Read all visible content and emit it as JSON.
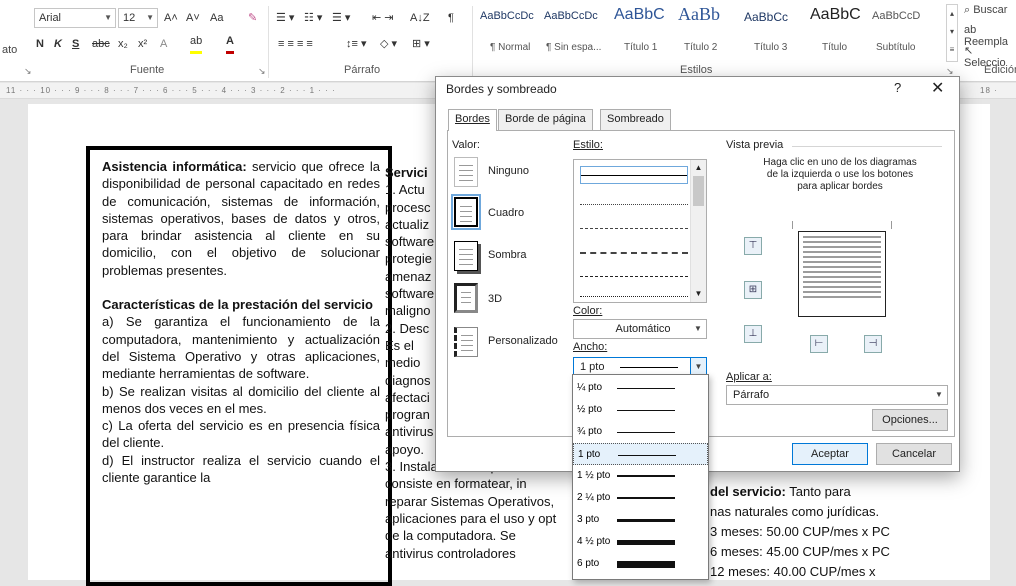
{
  "ribbon": {
    "font_name": "Arial",
    "font_size": "12",
    "grow_font": "A˄",
    "shrink_font": "A˅",
    "change_case": "Aa",
    "clear_format": "✎",
    "bold": "N",
    "italic": "K",
    "underline": "S",
    "strike": "abc",
    "subscript": "x₂",
    "superscript": "x²",
    "text_effects": "A",
    "highlight": "ab",
    "font_color": "A",
    "pilcrow": "¶",
    "sort": "A↓Z",
    "left_cut": "ato",
    "group_fuente": "Fuente",
    "group_parrafo": "Párrafo",
    "group_estilos": "Estilos",
    "group_edicion": "Edición",
    "buscar": "Buscar",
    "reemplazar": "Reempla",
    "seleccionar": "Seleccio",
    "styles": [
      {
        "sample": "AaBbCcDc",
        "name": "¶ Normal"
      },
      {
        "sample": "AaBbCcDc",
        "name": "¶ Sin espa..."
      },
      {
        "sample": "AaBbC",
        "name": "Título 1"
      },
      {
        "sample": "AaBb",
        "name": "Título 2"
      },
      {
        "sample": "AaBbCc",
        "name": "Título 3"
      },
      {
        "sample": "AaBbC",
        "name": "Título"
      },
      {
        "sample": "AaBbCcD",
        "name": "Subtítulo"
      }
    ],
    "ruler": "11 · · · 10 · · · 9 · · · 8 · · · 7 · · · 6 · · · 5 · · · 4 · · · 3 · · · 2 · · · 1 · · ·",
    "ruler_right": "18 ·"
  },
  "document": {
    "box": [
      {
        "bold": "Asistencia informática:",
        "text": " servicio que ofrece la disponibilidad de personal capacitado en redes de comunicación, sistemas de información, sistemas operativos, bases de datos y otros, para brindar asistencia al cliente en su domicilio, con el objetivo de solucionar problemas presentes."
      },
      {
        "bold": "Características de la prestación del servicio",
        "text": ""
      },
      {
        "bold": "",
        "text": "a) Se garantiza el funcionamiento de la computadora, mantenimiento y actualización del Sistema Operativo y otras aplicaciones, mediante herramientas de software."
      },
      {
        "bold": "",
        "text": "b) Se realizan visitas al domicilio del cliente al menos dos veces en el mes."
      },
      {
        "bold": "",
        "text": "c) La oferta del servicio es en presencia física del cliente."
      },
      {
        "bold": "",
        "text": "d) El instructor realiza el servicio cuando el cliente garantice la"
      }
    ],
    "col2": [
      "Servici",
      "1. Actu",
      "procesc",
      "actualiz",
      "software",
      "protegie",
      "amenaz",
      "software",
      "maligno",
      "2. Desc",
      "Es el",
      "medio",
      "diagnos",
      "afectaci",
      "progran",
      "antivirus",
      "apoyo.",
      "3. Instalación de aplicacion",
      "consiste en formatear, in",
      "reparar Sistemas Operativos,",
      "aplicaciones para el uso y opt",
      "de la computadora. Se",
      "antivirus controladores"
    ],
    "right_lines": [
      {
        "bold": "del servicio:",
        "text": " Tanto para"
      },
      {
        "bold": "",
        "text": "nas naturales como jurídicas."
      },
      {
        "bold": "",
        "text": "3 meses: 50.00 CUP/mes x PC"
      },
      {
        "bold": "",
        "text": "6 meses: 45.00 CUP/mes x PC"
      },
      {
        "bold": "",
        "text": "12 meses: 40.00 CUP/mes x"
      }
    ]
  },
  "dialog": {
    "title": "Bordes y sombreado",
    "help": "?",
    "close": "✕",
    "tabs": [
      "Bordes",
      "Borde de página",
      "Sombreado"
    ],
    "valor_label": "Valor:",
    "settings": [
      "Ninguno",
      "Cuadro",
      "Sombra",
      "3D",
      "Personalizado"
    ],
    "estilo_label": "Estilo:",
    "color_label": "Color:",
    "color_value": "Automático",
    "ancho_label": "Ancho:",
    "ancho_value": "1 pto",
    "preview_label": "Vista previa",
    "preview_hint": "Haga clic en uno de los diagramas de la izquierda o use los botones para aplicar bordes",
    "aplicar_label": "Aplicar a:",
    "aplicar_value": "Párrafo",
    "opciones": "Opciones...",
    "aceptar": "Aceptar",
    "cancelar": "Cancelar"
  },
  "width_options": [
    {
      "label": "¼ pto",
      "weight": 0.25
    },
    {
      "label": "½ pto",
      "weight": 0.5
    },
    {
      "label": "¾ pto",
      "weight": 0.75
    },
    {
      "label": "1 pto",
      "weight": 1
    },
    {
      "label": "1 ½ pto",
      "weight": 1.5
    },
    {
      "label": "2 ¼ pto",
      "weight": 2.25
    },
    {
      "label": "3 pto",
      "weight": 3
    },
    {
      "label": "4 ½ pto",
      "weight": 4.5
    },
    {
      "label": "6 pto",
      "weight": 6
    }
  ],
  "selected_width": "1 pto",
  "colors": {
    "accent": "#0078d7",
    "selection": "#6fa8dc",
    "heading": "#1f3864"
  }
}
